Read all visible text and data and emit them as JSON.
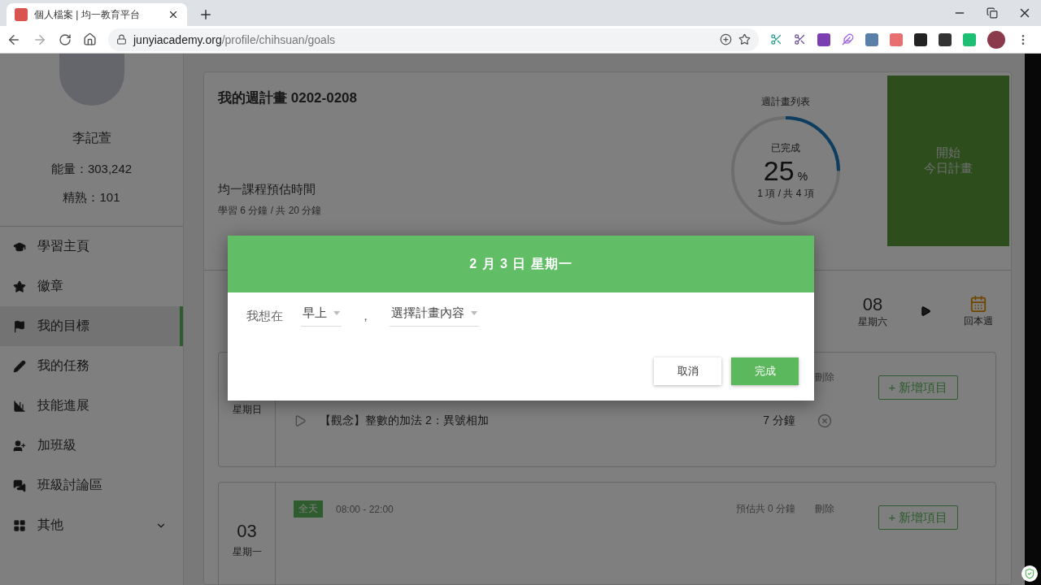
{
  "browser": {
    "tab_title": "個人檔案 | 均一教育平台",
    "url_host": "junyiacademy.org",
    "url_path": "/profile/chihsuan/goals"
  },
  "sidebar": {
    "user_name": "李記萱",
    "stats": [
      "能量：303,242",
      "精熟：101"
    ],
    "items": [
      {
        "label": "學習主頁",
        "selected": false
      },
      {
        "label": "徽章",
        "selected": false
      },
      {
        "label": "我的目標",
        "selected": true
      },
      {
        "label": "我的任務",
        "selected": false
      },
      {
        "label": "技能進展",
        "selected": false
      },
      {
        "label": "加班級",
        "selected": false
      },
      {
        "label": "班級討論區",
        "selected": false
      },
      {
        "label": "其他",
        "selected": false
      }
    ]
  },
  "plan": {
    "title": "我的週計畫 0202-0208",
    "estimate_label": "均一課程預估時間",
    "estimate_detail": "學習 6 分鐘 / 共 20 分鐘",
    "progress": {
      "caption": "週計畫列表",
      "label": "已完成",
      "percent": "25",
      "unit": "%",
      "count": "1 項 / 共 4 項",
      "level": 0.25
    },
    "start_button": [
      "開始",
      "今日計畫"
    ]
  },
  "week_nav": {
    "day": "08",
    "weekday": "星期六",
    "back": "回本週"
  },
  "days": [
    {
      "weekday": "星期日",
      "delete_header": "刪除",
      "add_button": "+ 新增項目",
      "items": [
        {
          "text": "【觀念】整數的加法 2：異號相加",
          "minutes": "7 分鐘"
        }
      ]
    },
    {
      "day": "03",
      "weekday": "星期一",
      "tag": "全天",
      "hours": "08:00 - 22:00",
      "estimate": "預估共 0 分鐘",
      "delete_header": "刪除",
      "add_button": "+ 新增項目"
    }
  ],
  "modal": {
    "title": "2 月 3 日 星期一",
    "prefix": "我想在",
    "time_value": "早上",
    "separator": "，",
    "plan_placeholder": "選擇計畫內容",
    "cancel": "取消",
    "confirm": "完成"
  }
}
